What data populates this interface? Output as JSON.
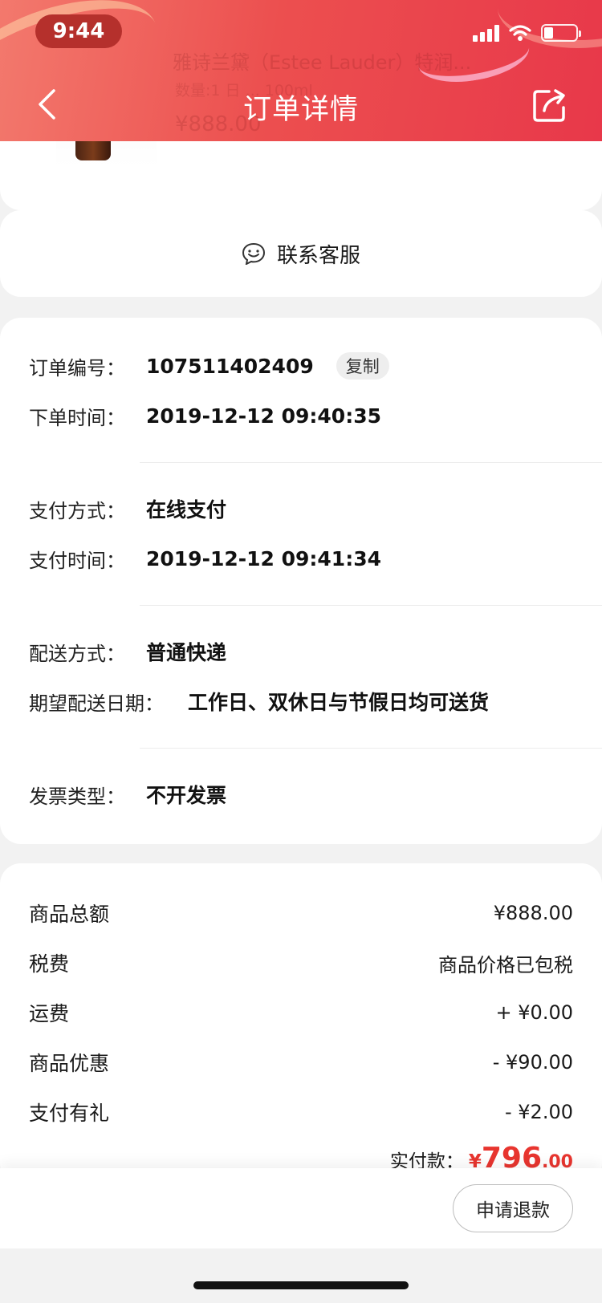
{
  "status_bar": {
    "time": "9:44"
  },
  "header": {
    "title": "订单详情",
    "back_icon": "chevron-left-icon",
    "share_icon": "share-icon"
  },
  "product": {
    "name_partial": "雅诗兰黛（Estee Lauder）特润...",
    "spec_partial": "数量:1  日 ...   100ml",
    "price_partial": "¥888.00"
  },
  "service": {
    "label": "联系客服",
    "icon": "chat-smile-icon"
  },
  "order_info": {
    "order_no_label": "订单编号：",
    "order_no": "107511402409",
    "copy_label": "复制",
    "order_time_label": "下单时间：",
    "order_time": "2019-12-12 09:40:35",
    "pay_method_label": "支付方式：",
    "pay_method": "在线支付",
    "pay_time_label": "支付时间：",
    "pay_time": "2019-12-12 09:41:34",
    "delivery_method_label": "配送方式：",
    "delivery_method": "普通快递",
    "delivery_date_label": "期望配送日期：",
    "delivery_date": "工作日、双休日与节假日均可送货",
    "invoice_label": "发票类型：",
    "invoice": "不开发票"
  },
  "amounts": {
    "items": [
      {
        "label": "商品总额",
        "value": "¥888.00"
      },
      {
        "label": "税费",
        "value": "商品价格已包税"
      },
      {
        "label": "运费",
        "value": "+ ¥0.00"
      },
      {
        "label": "商品优惠",
        "value": "- ¥90.00"
      },
      {
        "label": "支付有礼",
        "value": "- ¥2.00"
      }
    ],
    "paid_label": "实付款：",
    "paid_yen": "¥",
    "paid_int": "796",
    "paid_dec": ".00",
    "accent_color": "#e8352f"
  },
  "actions": {
    "refund_label": "申请退款"
  }
}
